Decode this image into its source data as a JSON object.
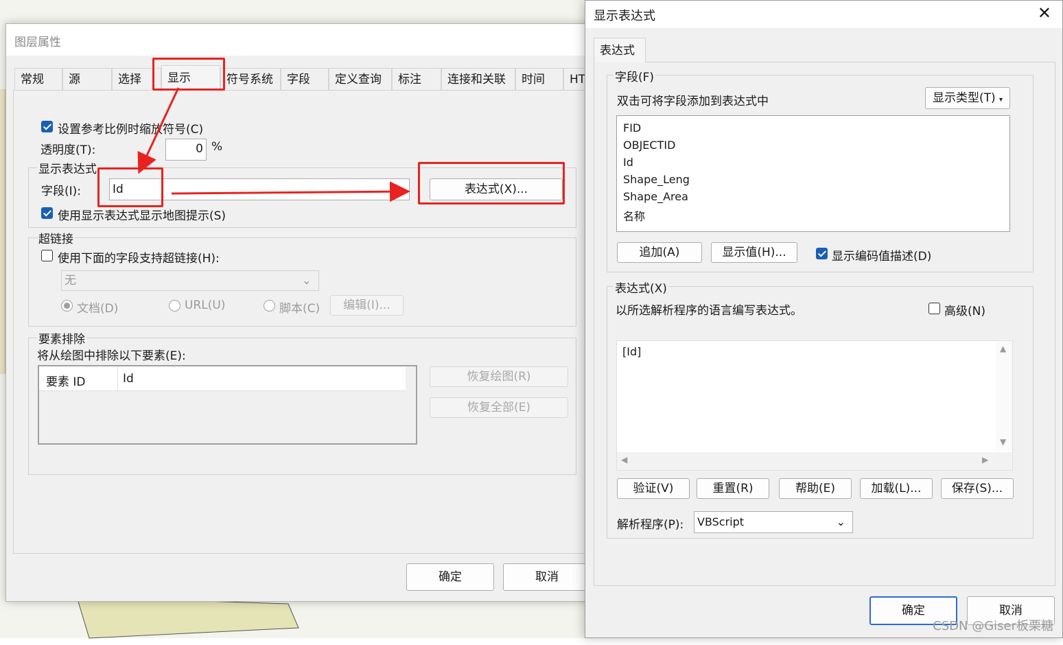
{
  "layer_props": {
    "title": "图层属性",
    "tabs": [
      "常规",
      "源",
      "选择",
      "显示",
      "符号系统",
      "字段",
      "定义查询",
      "标注",
      "连接和关联",
      "时间",
      "HTM"
    ],
    "active_tab": "显示",
    "scale_symbols_label": "设置参考比例时缩放符号(C)",
    "scale_symbols_checked": true,
    "transparency_label": "透明度(T):",
    "transparency_value": "0",
    "transparency_unit": "%",
    "display_expr_group": "显示表达式",
    "field_label": "字段(I):",
    "field_value": "Id",
    "expr_button": "表达式(X)...",
    "use_maptips_label": "使用显示表达式显示地图提示(S)",
    "use_maptips_checked": true,
    "hyperlink_group": "超链接",
    "hyperlink_support_label": "使用下面的字段支持超链接(H):",
    "hyperlink_support_checked": false,
    "hyperlink_field_value": "无",
    "radio_document": "文档(D)",
    "radio_url": "URL(U)",
    "radio_script": "脚本(C)",
    "edit_button": "编辑(I)...",
    "exclusion_group": "要素排除",
    "exclusion_label": "将从绘图中排除以下要素(E):",
    "exclusion_columns": [
      "要素 ID",
      "Id"
    ],
    "restore_draw_button": "恢复绘图(R)",
    "restore_all_button": "恢复全部(E)",
    "ok_button": "确定",
    "cancel_button": "取消"
  },
  "expr_dialog": {
    "title": "显示表达式",
    "close_glyph": "✕",
    "tab": "表达式",
    "fields_group": "字段(F)",
    "fields_hint": "双击可将字段添加到表达式中",
    "show_type_button": "显示类型(T)",
    "fields": [
      "FID",
      "OBJECTID",
      "Id",
      "Shape_Leng",
      "Shape_Area",
      "名称"
    ],
    "append_button": "追加(A)",
    "show_values_button": "显示值(H)...",
    "show_coded_label": "显示编码值描述(D)",
    "show_coded_checked": true,
    "expr_group": "表达式(X)",
    "expr_hint": "以所选解析程序的语言编写表达式。",
    "advanced_label": "高级(N)",
    "advanced_checked": false,
    "expression": "[Id]",
    "verify_button": "验证(V)",
    "reset_button": "重置(R)",
    "help_button": "帮助(E)",
    "load_button": "加载(L)...",
    "save_button": "保存(S)...",
    "parser_label": "解析程序(P):",
    "parser_value": "VBScript",
    "ok_button": "确定",
    "cancel_button": "取消"
  },
  "watermark": "CSDN @Giser板栗糖",
  "colors": {
    "annotation_red": "#e8231f",
    "checkbox_blue": "#1a5fb4",
    "primary_border": "#2a6bd6"
  }
}
